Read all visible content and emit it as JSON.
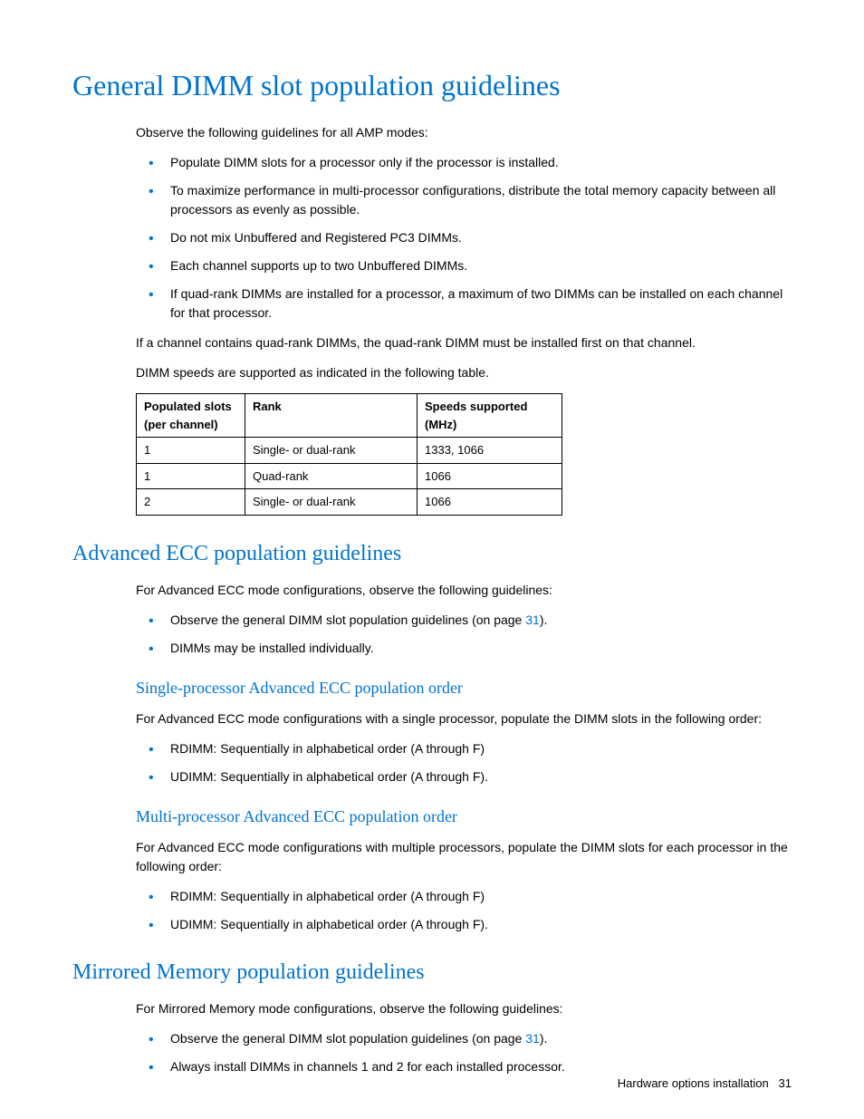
{
  "h1": "General DIMM slot population guidelines",
  "intro": "Observe the following guidelines for all AMP modes:",
  "bullets1": [
    "Populate DIMM slots for a processor only if the processor is installed.",
    "To maximize performance in multi-processor configurations, distribute the total memory capacity between all processors as evenly as possible.",
    "Do not mix Unbuffered and Registered PC3 DIMMs.",
    "Each channel supports up to two Unbuffered DIMMs.",
    "If quad-rank DIMMs are installed for a processor, a maximum of two DIMMs can be installed on each channel for that processor."
  ],
  "para_after_bullets1": "If a channel contains quad-rank DIMMs, the quad-rank DIMM must be installed first on that channel.",
  "para_table_intro": "DIMM speeds are supported as indicated in the following table.",
  "table": {
    "headers": [
      "Populated slots (per channel)",
      "Rank",
      "Speeds supported (MHz)"
    ],
    "rows": [
      [
        "1",
        "Single- or dual-rank",
        "1333, 1066"
      ],
      [
        "1",
        "Quad-rank",
        "1066"
      ],
      [
        "2",
        "Single- or dual-rank",
        "1066"
      ]
    ]
  },
  "h2_ecc": "Advanced ECC population guidelines",
  "ecc_intro": "For Advanced ECC mode configurations, observe the following guidelines:",
  "ecc_bullet1_pre": "Observe the general DIMM slot population guidelines (on page ",
  "ecc_bullet1_link": "31",
  "ecc_bullet1_post": ").",
  "ecc_bullet2": "DIMMs may be installed individually.",
  "h3_single": "Single-processor Advanced ECC population order",
  "single_intro": "For Advanced ECC mode configurations with a single processor, populate the DIMM slots in the following order:",
  "single_bullets": [
    "RDIMM: Sequentially in alphabetical order (A through F)",
    "UDIMM: Sequentially in alphabetical order (A through F)."
  ],
  "h3_multi": "Multi-processor Advanced ECC population order",
  "multi_intro": "For Advanced ECC mode configurations with multiple processors, populate the DIMM slots for each processor in the following order:",
  "multi_bullets": [
    "RDIMM: Sequentially in alphabetical order (A through F)",
    "UDIMM: Sequentially in alphabetical order (A through F)."
  ],
  "h2_mirrored": "Mirrored Memory population guidelines",
  "mirrored_intro": "For Mirrored Memory mode configurations, observe the following guidelines:",
  "mirrored_bullet1_pre": "Observe the general DIMM slot population guidelines (on page ",
  "mirrored_bullet1_link": "31",
  "mirrored_bullet1_post": ").",
  "mirrored_bullet2": "Always install DIMMs in channels 1 and 2 for each installed processor.",
  "footer_text": "Hardware options installation",
  "footer_page": "31"
}
